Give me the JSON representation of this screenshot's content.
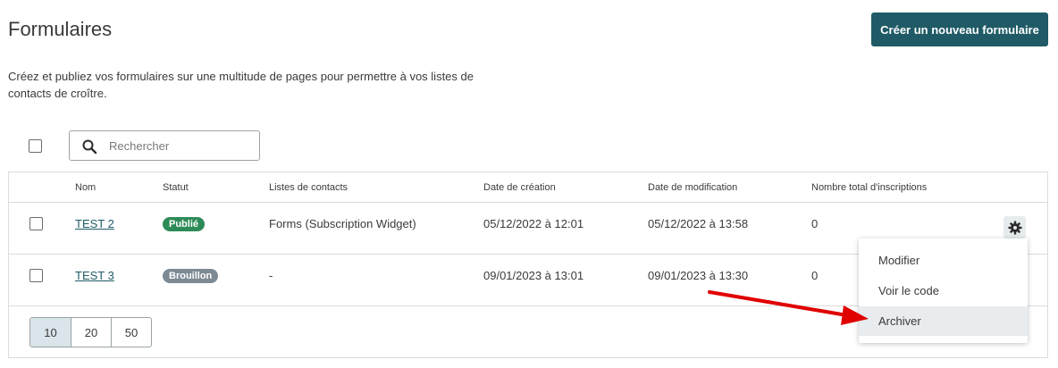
{
  "header": {
    "title": "Formulaires",
    "create_label": "Créer un nouveau formulaire"
  },
  "description": "Créez et publiez vos formulaires sur une multitude de pages pour permettre à vos listes de contacts de croître.",
  "search": {
    "placeholder": "Rechercher",
    "value": ""
  },
  "table": {
    "headers": {
      "name": "Nom",
      "status": "Statut",
      "lists": "Listes de contacts",
      "created": "Date de création",
      "modified": "Date de modification",
      "total": "Nombre total d'inscriptions"
    },
    "rows": [
      {
        "name": "TEST 2",
        "status": "Publié",
        "lists": "Forms (Subscription Widget)",
        "created": "05/12/2022 à 12:01",
        "modified": "05/12/2022 à 13:58",
        "total": "0"
      },
      {
        "name": "TEST 3",
        "status": "Brouillon",
        "lists": "-",
        "created": "09/01/2023 à 13:01",
        "modified": "09/01/2023 à 13:30",
        "total": "0"
      }
    ]
  },
  "menu": {
    "items": [
      "Modifier",
      "Voir le code",
      "Archiver"
    ],
    "highlighted": "Archiver"
  },
  "pagination": {
    "sizes": [
      "10",
      "20",
      "50"
    ],
    "selected": "10"
  },
  "colors": {
    "primary": "#1f5a66",
    "published": "#2e8b57",
    "draft": "#7d8a94",
    "annotation_arrow": "#e00000"
  },
  "icons": {
    "search": "search-icon",
    "gear": "gear-icon",
    "arrow": "red-arrow-annotation"
  }
}
